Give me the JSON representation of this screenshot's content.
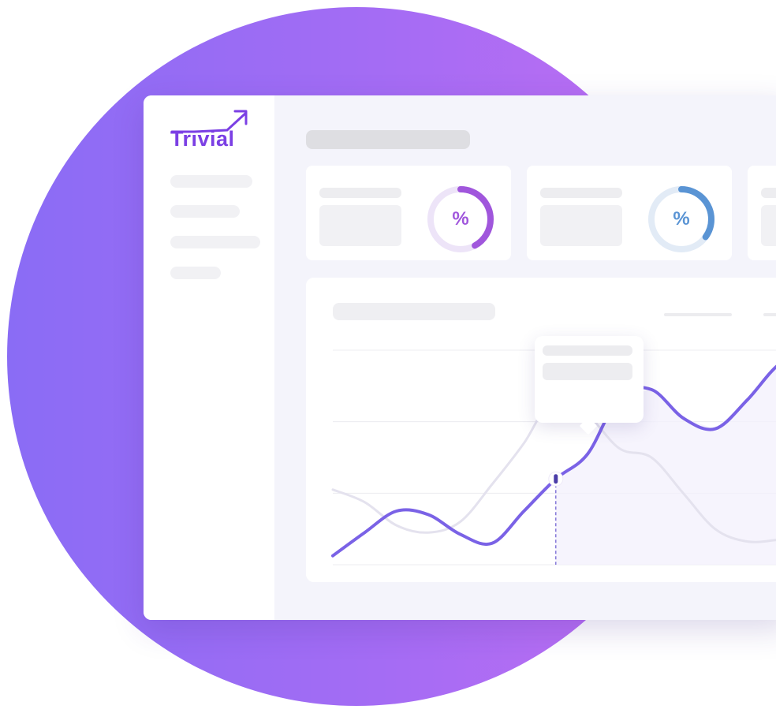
{
  "brand": {
    "name": "Trivial",
    "color": "#7b3fe4"
  },
  "background": {
    "gradient_start": "#8a6cf5",
    "gradient_end": "#c06ef2"
  },
  "cards": [
    {
      "symbol": "%",
      "accent": "#a056dc",
      "track": "#ede4f8",
      "progress": 0.42
    },
    {
      "symbol": "%",
      "accent": "#5a94d4",
      "track": "#e2ebf6",
      "progress": 0.35
    }
  ],
  "icons": {
    "trend": "trend-up-arrow-icon",
    "marker": "marker-dot-icon"
  },
  "chart_data": {
    "type": "line",
    "series": [
      {
        "color": "#7a62e6",
        "values": [
          5,
          18,
          30,
          28,
          17,
          12,
          30,
          48,
          62,
          94,
          98,
          82,
          76,
          92,
          112,
          120
        ]
      },
      {
        "color": "#e4e2ee",
        "values": [
          42,
          35,
          22,
          18,
          24,
          45,
          68,
          95,
          84,
          65,
          60,
          40,
          20,
          13,
          14,
          16
        ]
      }
    ],
    "ylim": [
      0,
      120
    ],
    "grid": true,
    "highlight_index": 7
  }
}
